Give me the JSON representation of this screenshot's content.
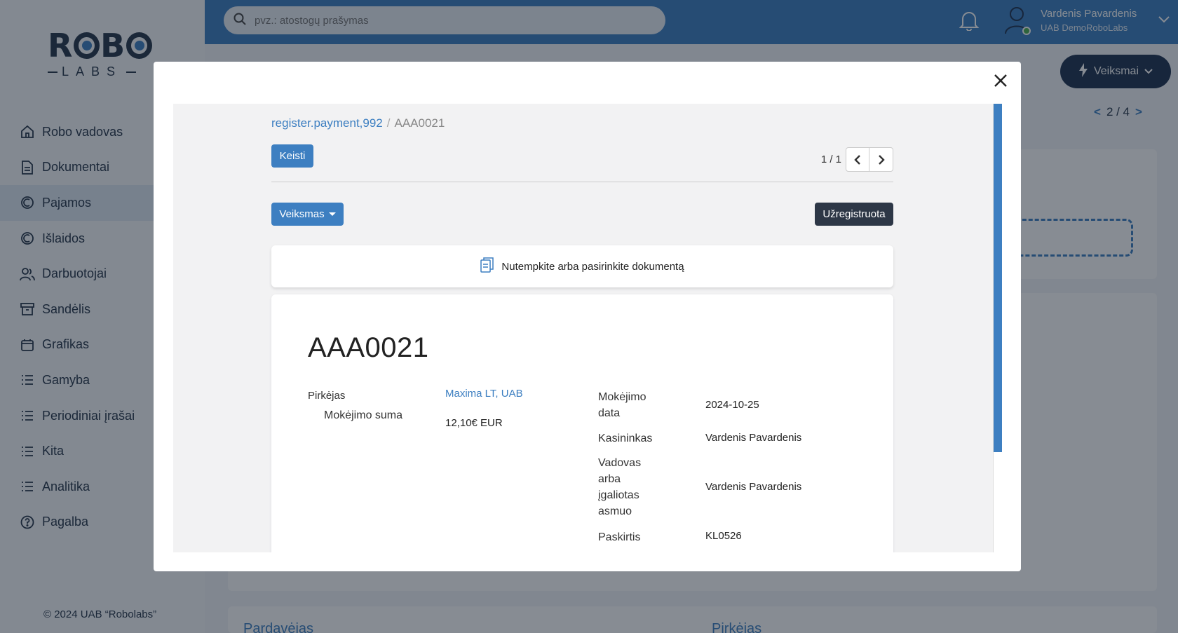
{
  "sidebar": {
    "logo": {
      "top": "ROBO",
      "bottom": "LABS"
    },
    "items": [
      {
        "label": "Robo vadovas",
        "icon": "home-icon"
      },
      {
        "label": "Dokumentai",
        "icon": "document-icon"
      },
      {
        "label": "Pajamos",
        "icon": "income-icon",
        "active": true
      },
      {
        "label": "Išlaidos",
        "icon": "expense-icon"
      },
      {
        "label": "Darbuotojai",
        "icon": "users-icon"
      },
      {
        "label": "Sandėlis",
        "icon": "archive-icon"
      },
      {
        "label": "Grafikas",
        "icon": "calendar-icon"
      },
      {
        "label": "Gamyba",
        "icon": "list-icon"
      },
      {
        "label": "Periodiniai įrašai",
        "icon": "list-icon"
      },
      {
        "label": "Kita",
        "icon": "list-icon"
      },
      {
        "label": "Analitika",
        "icon": "list-icon"
      },
      {
        "label": "Pagalba",
        "icon": "help-icon"
      }
    ],
    "copyright": "© 2024 UAB “Robolabs”"
  },
  "header": {
    "search_placeholder": "pvz.: atostogų prašymas",
    "user_name": "Vardenis Pavardenis",
    "user_company": "UAB DemoRoboLabs"
  },
  "background": {
    "actions_label": "Veiksmai",
    "pager": {
      "prev": "<",
      "text": "2 / 4",
      "next": ">"
    },
    "seller_label": "Pardavėjas",
    "buyer_label": "Pirkėjas"
  },
  "modal": {
    "breadcrumb": {
      "parent": "register.payment,992",
      "separator": "/",
      "current": "AAA0021"
    },
    "edit_label": "Keisti",
    "pager_text": "1 / 1",
    "actions_label": "Veiksmas",
    "status": "Užregistruota",
    "dropzone_text": "Nutempkite arba pasirinkite dokumentą",
    "document": {
      "title": "AAA0021",
      "left_fields": [
        {
          "label": "Pirkėjas",
          "value": "Maxima LT, UAB"
        },
        {
          "label": "Mokėjimo suma",
          "value": "12,10€ EUR"
        }
      ],
      "right_fields": [
        {
          "label": "Mokėjimo data",
          "value": "2024-10-25"
        },
        {
          "label": "Kasininkas",
          "value": "Vardenis Pavardenis"
        },
        {
          "label": "Vadovas arba įgaliotas asmuo",
          "value": "Vardenis Pavardenis"
        },
        {
          "label": "Paskirtis",
          "value": "KL0526"
        }
      ]
    }
  },
  "colors": {
    "primary": "#3d7fc1",
    "dark": "#1f3350",
    "badge": "#2d3746",
    "text": "#26364a"
  }
}
